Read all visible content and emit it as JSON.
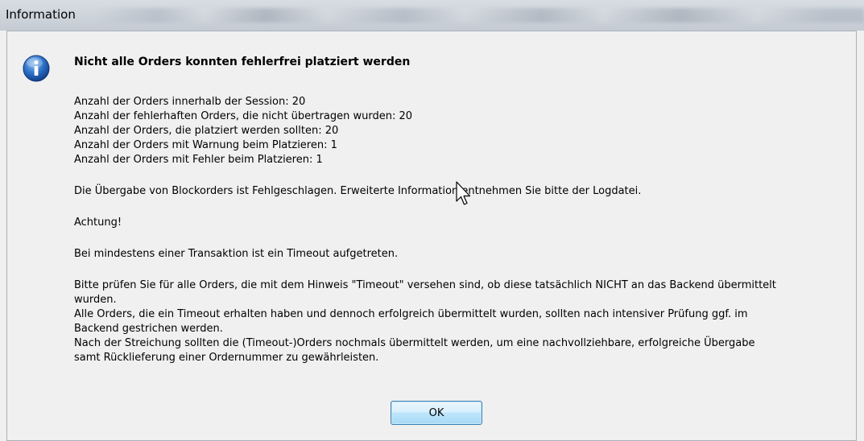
{
  "window": {
    "title": "Information"
  },
  "dialog": {
    "icon": "info-icon",
    "heading": "Nicht alle Orders konnten fehlerfrei platziert werden",
    "stats": [
      "Anzahl der Orders innerhalb der Session: 20",
      "Anzahl der fehlerhaften Orders, die nicht übertragen wurden: 20",
      "Anzahl der Orders, die platziert werden sollten: 20",
      "Anzahl der Orders mit Warnung beim Platzieren: 1",
      "Anzahl der Orders mit Fehler beim Platzieren: 1"
    ],
    "failure_line": "Die Übergabe von Blockorders ist Fehlgeschlagen. Erweiterte Information entnehmen Sie bitte der Logdatei.",
    "warning_label": "Achtung!",
    "timeout_line": "Bei mindestens einer Transaktion ist ein Timeout aufgetreten.",
    "instructions": [
      "Bitte prüfen Sie für alle Orders, die mit dem Hinweis \"Timeout\" versehen sind, ob diese tatsächlich NICHT an das Backend übermittelt",
      "wurden.",
      "Alle Orders, die ein Timeout erhalten haben und dennoch erfolgreich übermittelt wurden, sollten nach intensiver Prüfung ggf. im",
      "Backend gestrichen werden.",
      "Nach der Streichung sollten die (Timeout-)Orders nochmals übermittelt werden, um eine nachvollziehbare, erfolgreiche Übergabe",
      "samt Rücklieferung einer Ordernummer zu gewährleisten."
    ],
    "ok_label": "OK"
  },
  "colors": {
    "icon_blue": "#1f5fb8",
    "button_border": "#3c7fb1"
  }
}
